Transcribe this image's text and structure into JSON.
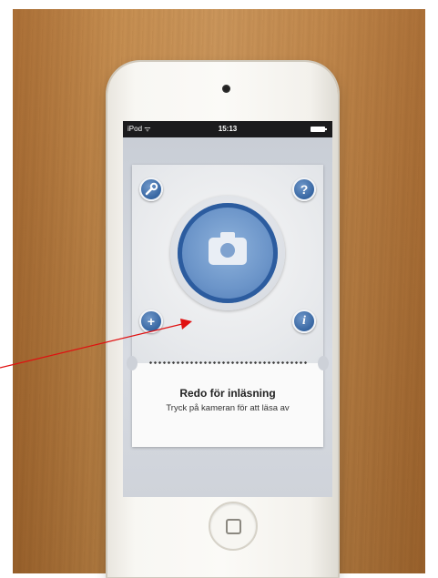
{
  "status_bar": {
    "carrier": "iPod ᯤ",
    "time": "15:13"
  },
  "card": {
    "title": "Redo för inläsning",
    "subtitle": "Tryck på kameran för att läsa av",
    "buttons": {
      "help_label": "?",
      "add_label": "+",
      "info_label": "i"
    }
  },
  "icons": [
    "wrench-icon",
    "help-icon",
    "camera-icon",
    "plus-icon",
    "info-icon",
    "battery-icon",
    "wifi-icon"
  ],
  "colors": {
    "accent": "#2f5f9c",
    "annotation_arrow": "#e01010"
  }
}
